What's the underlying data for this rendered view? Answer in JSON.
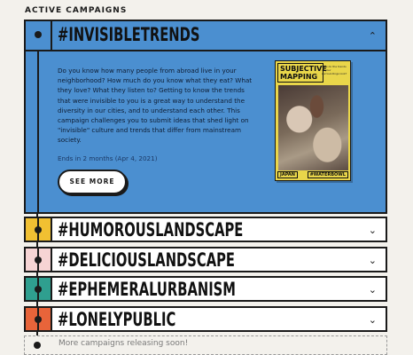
{
  "section": {
    "title": "ACTIVE CAMPAIGNS"
  },
  "campaigns": [
    {
      "tag": "#INVISIBLETRENDS",
      "color": "#4b8fd0",
      "expanded": true,
      "description": "Do you know how many people from abroad live in your neighborhood? How much do you know what they eat? What they love? What they listen to? Getting to know the trends that were invisible to you is a great way to understand the diversity in our cities, and to understand each other. This campaign challenges you to submit ideas that shed light on \"invisible\" culture and trends that differ from mainstream society.",
      "ends": "Ends in 2 months (Apr 4, 2021)",
      "button": "SEE MORE",
      "poster": {
        "title": "SUBJECTIVE MAPPING",
        "note": "How do the trends of your surroundings look?",
        "footer_left": "JAPAN",
        "footer_right": "#WATERBOWL"
      }
    },
    {
      "tag": "#HUMOROUSLANDSCAPE",
      "color": "#f1c032"
    },
    {
      "tag": "#DELICIOUSLANDSCAPE",
      "color": "#f6d4d4"
    },
    {
      "tag": "#EPHEMERALURBANISM",
      "color": "#2f9f8f"
    },
    {
      "tag": "#LONELYPUBLIC",
      "color": "#e8643a"
    }
  ],
  "more_text": "More campaigns releasing soon!",
  "icons": {
    "expanded": "chevron-up-icon",
    "collapsed": "chevron-down-icon"
  }
}
